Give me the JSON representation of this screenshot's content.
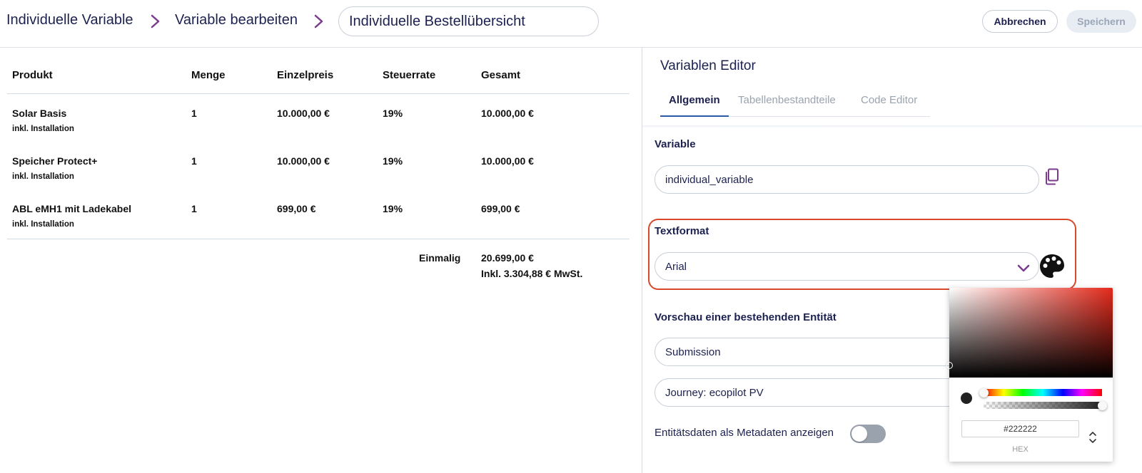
{
  "header": {
    "breadcrumb_1": "Individuelle Variable",
    "breadcrumb_2": "Variable bearbeiten",
    "title_value": "Individuelle Bestellübersicht",
    "cancel_label": "Abbrechen",
    "save_label": "Speichern"
  },
  "table": {
    "columns": [
      "Produkt",
      "Menge",
      "Einzelpreis",
      "Steuerrate",
      "Gesamt"
    ],
    "rows": [
      {
        "product": "Solar Basis",
        "note": "inkl. Installation",
        "qty": "1",
        "unit_price": "10.000,00 €",
        "tax": "19%",
        "total": "10.000,00 €"
      },
      {
        "product": "Speicher Protect+",
        "note": "inkl. Installation",
        "qty": "1",
        "unit_price": "10.000,00 €",
        "tax": "19%",
        "total": "10.000,00 €"
      },
      {
        "product": "ABL eMH1 mit Ladekabel",
        "note": "inkl. Installation",
        "qty": "1",
        "unit_price": "699,00 €",
        "tax": "19%",
        "total": "699,00 €"
      }
    ],
    "summary": {
      "label": "Einmalig",
      "total": "20.699,00 €",
      "vat": "Inkl. 3.304,88 € MwSt."
    }
  },
  "editor": {
    "title": "Variablen Editor",
    "tabs": [
      {
        "label": "Allgemein",
        "active": true
      },
      {
        "label": "Tabellenbestandteile",
        "active": false
      },
      {
        "label": "Code Editor",
        "active": false
      }
    ],
    "variable_label": "Variable",
    "variable_value": "individual_variable",
    "textformat_label": "Textformat",
    "font_value": "Arial",
    "preview_label": "Vorschau einer bestehenden Entität",
    "entity_type": "Submission",
    "entity_value": "Journey: ecopilot PV",
    "metadata_toggle_label": "Entitätsdaten als Metadaten anzeigen",
    "metadata_toggle_on": false
  },
  "color_picker": {
    "hex_value": "#222222",
    "mode_label": "HEX",
    "hue_color": "#e52a1c",
    "selected_color": "#222222"
  },
  "colors": {
    "primary_text": "#1c2150",
    "accent_purple": "#7b3b8f",
    "active_tab": "#2a5aa6",
    "highlight_border": "#d9482b"
  }
}
